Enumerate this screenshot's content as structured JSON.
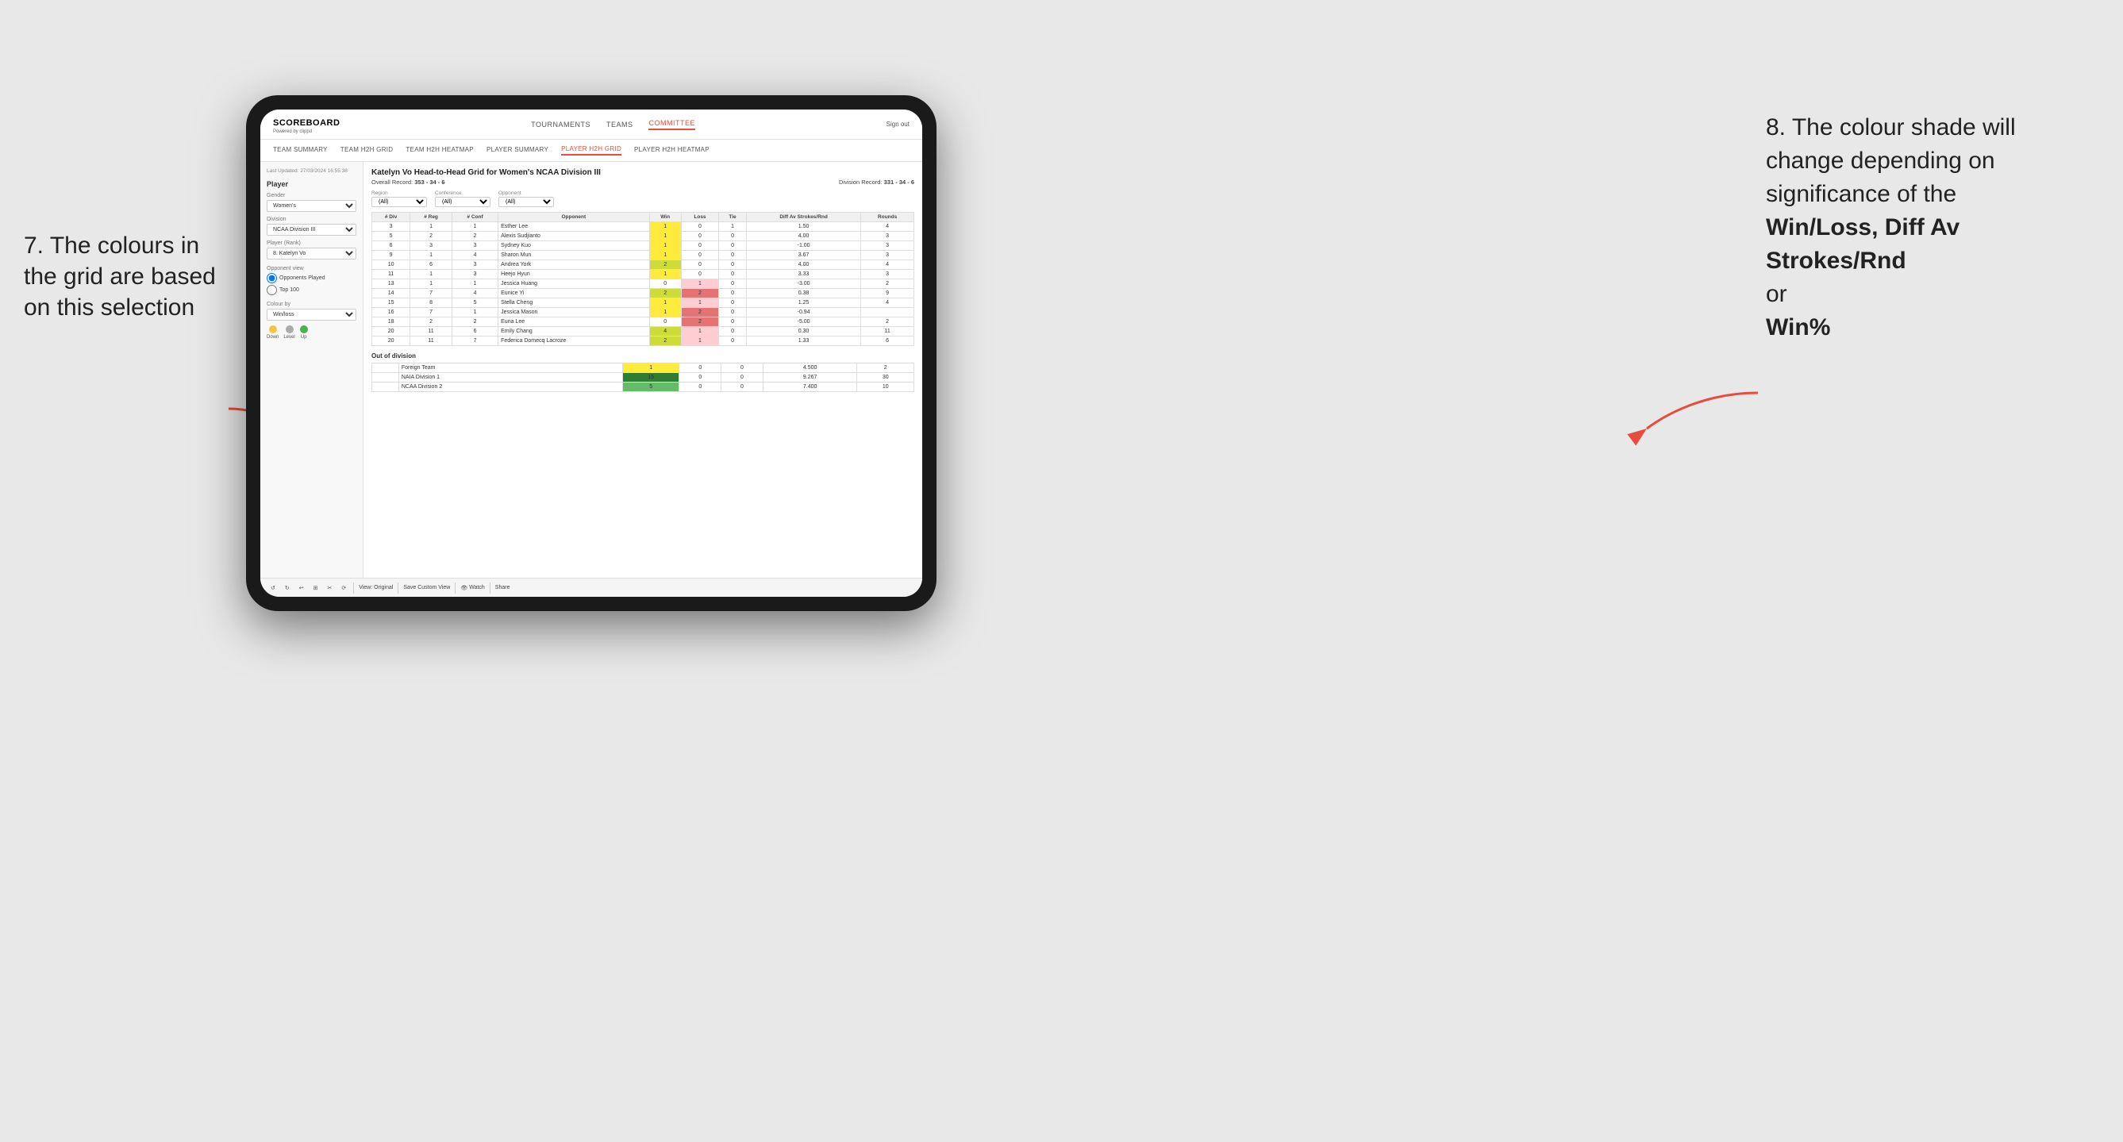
{
  "annotations": {
    "left_title": "7. The colours in the grid are based on this selection",
    "right_title": "8. The colour shade will change depending on significance of the",
    "right_bold1": "Win/Loss,",
    "right_bold2": "Diff Av Strokes/Rnd",
    "right_or": "or",
    "right_bold3": "Win%"
  },
  "nav": {
    "logo": "SCOREBOARD",
    "logo_sub": "Powered by clippd",
    "items": [
      "TOURNAMENTS",
      "TEAMS",
      "COMMITTEE"
    ],
    "active": "COMMITTEE",
    "sign_out": "Sign out"
  },
  "sub_nav": {
    "items": [
      "TEAM SUMMARY",
      "TEAM H2H GRID",
      "TEAM H2H HEATMAP",
      "PLAYER SUMMARY",
      "PLAYER H2H GRID",
      "PLAYER H2H HEATMAP"
    ],
    "active": "PLAYER H2H GRID"
  },
  "sidebar": {
    "timestamp": "Last Updated: 27/03/2024 16:55:38",
    "player_section": "Player",
    "gender_label": "Gender",
    "gender_value": "Women's",
    "division_label": "Division",
    "division_value": "NCAA Division III",
    "player_rank_label": "Player (Rank)",
    "player_rank_value": "8. Katelyn Vo",
    "opponent_view_title": "Opponent view",
    "radio1": "Opponents Played",
    "radio2": "Top 100",
    "colour_by_label": "Colour by",
    "colour_by_value": "Win/loss",
    "legend": [
      {
        "color": "#f5c542",
        "label": "Down"
      },
      {
        "color": "#aaa",
        "label": "Level"
      },
      {
        "color": "#4caf50",
        "label": "Up"
      }
    ]
  },
  "grid": {
    "title": "Katelyn Vo Head-to-Head Grid for Women's NCAA Division III",
    "overall_record_label": "Overall Record:",
    "overall_record_value": "353 - 34 - 6",
    "division_record_label": "Division Record:",
    "division_record_value": "331 - 34 - 6",
    "filters": {
      "region_label": "Region",
      "region_value": "(All)",
      "conference_label": "Conference",
      "conference_value": "(All)",
      "opponent_label": "Opponent",
      "opponent_value": "(All)"
    },
    "columns": [
      "# Div",
      "# Reg",
      "# Conf",
      "Opponent",
      "Win",
      "Loss",
      "Tie",
      "Diff Av Strokes/Rnd",
      "Rounds"
    ],
    "rows": [
      {
        "div": "3",
        "reg": "1",
        "conf": "1",
        "opponent": "Esther Lee",
        "win": "1",
        "loss": "0",
        "tie": "1",
        "diff": "1.50",
        "rounds": "4",
        "win_color": "neutral",
        "loss_color": "neutral"
      },
      {
        "div": "5",
        "reg": "2",
        "conf": "2",
        "opponent": "Alexis Sudjianto",
        "win": "1",
        "loss": "0",
        "tie": "0",
        "diff": "4.00",
        "rounds": "3",
        "win_color": "win-light-green",
        "loss_color": "neutral"
      },
      {
        "div": "6",
        "reg": "3",
        "conf": "3",
        "opponent": "Sydney Kuo",
        "win": "1",
        "loss": "0",
        "tie": "0",
        "diff": "-1.00",
        "rounds": "3",
        "win_color": "win-yellow",
        "loss_color": "neutral"
      },
      {
        "div": "9",
        "reg": "1",
        "conf": "4",
        "opponent": "Sharon Mun",
        "win": "1",
        "loss": "0",
        "tie": "0",
        "diff": "3.67",
        "rounds": "3",
        "win_color": "win-light-green",
        "loss_color": "neutral"
      },
      {
        "div": "10",
        "reg": "6",
        "conf": "3",
        "opponent": "Andrea York",
        "win": "2",
        "loss": "0",
        "tie": "0",
        "diff": "4.00",
        "rounds": "4",
        "win_color": "win-light-green",
        "loss_color": "neutral"
      },
      {
        "div": "11",
        "reg": "1",
        "conf": "3",
        "opponent": "Heejo Hyun",
        "win": "1",
        "loss": "0",
        "tie": "0",
        "diff": "3.33",
        "rounds": "3",
        "win_color": "win-light-green",
        "loss_color": "neutral"
      },
      {
        "div": "13",
        "reg": "1",
        "conf": "1",
        "opponent": "Jessica Huang",
        "win": "0",
        "loss": "1",
        "tie": "0",
        "diff": "-3.00",
        "rounds": "2",
        "win_color": "neutral",
        "loss_color": "loss-light"
      },
      {
        "div": "14",
        "reg": "7",
        "conf": "4",
        "opponent": "Eunice Yi",
        "win": "2",
        "loss": "2",
        "tie": "0",
        "diff": "0.38",
        "rounds": "9",
        "win_color": "win-yellow",
        "loss_color": "loss-light"
      },
      {
        "div": "15",
        "reg": "8",
        "conf": "5",
        "opponent": "Stella Cheng",
        "win": "1",
        "loss": "1",
        "tie": "0",
        "diff": "1.25",
        "rounds": "4",
        "win_color": "win-yellow",
        "loss_color": "loss-light"
      },
      {
        "div": "16",
        "reg": "7",
        "conf": "1",
        "opponent": "Jessica Mason",
        "win": "1",
        "loss": "2",
        "tie": "0",
        "diff": "-0.94",
        "rounds": "",
        "win_color": "win-yellow",
        "loss_color": "loss-med"
      },
      {
        "div": "18",
        "reg": "2",
        "conf": "2",
        "opponent": "Euna Lee",
        "win": "0",
        "loss": "2",
        "tie": "0",
        "diff": "-5.00",
        "rounds": "2",
        "win_color": "neutral",
        "loss_color": "loss-dark"
      },
      {
        "div": "20",
        "reg": "11",
        "conf": "6",
        "opponent": "Emily Chang",
        "win": "4",
        "loss": "1",
        "tie": "0",
        "diff": "0.30",
        "rounds": "11",
        "win_color": "win-yellow",
        "loss_color": "loss-light"
      },
      {
        "div": "20",
        "reg": "11",
        "conf": "7",
        "opponent": "Federica Domecq Lacroze",
        "win": "2",
        "loss": "1",
        "tie": "0",
        "diff": "1.33",
        "rounds": "6",
        "win_color": "win-yellow",
        "loss_color": "loss-light"
      }
    ],
    "out_of_division_title": "Out of division",
    "out_rows": [
      {
        "opponent": "Foreign Team",
        "win": "1",
        "loss": "0",
        "tie": "0",
        "diff": "4.500",
        "rounds": "2",
        "win_color": "win-light-green",
        "loss_color": "neutral"
      },
      {
        "opponent": "NAIA Division 1",
        "win": "15",
        "loss": "0",
        "tie": "0",
        "diff": "9.267",
        "rounds": "30",
        "win_color": "win-dark-green",
        "loss_color": "neutral"
      },
      {
        "opponent": "NCAA Division 2",
        "win": "5",
        "loss": "0",
        "tie": "0",
        "diff": "7.400",
        "rounds": "10",
        "win_color": "win-med-green",
        "loss_color": "neutral"
      }
    ]
  },
  "toolbar": {
    "view_original": "View: Original",
    "save_custom": "Save Custom View",
    "watch": "Watch",
    "share": "Share"
  }
}
